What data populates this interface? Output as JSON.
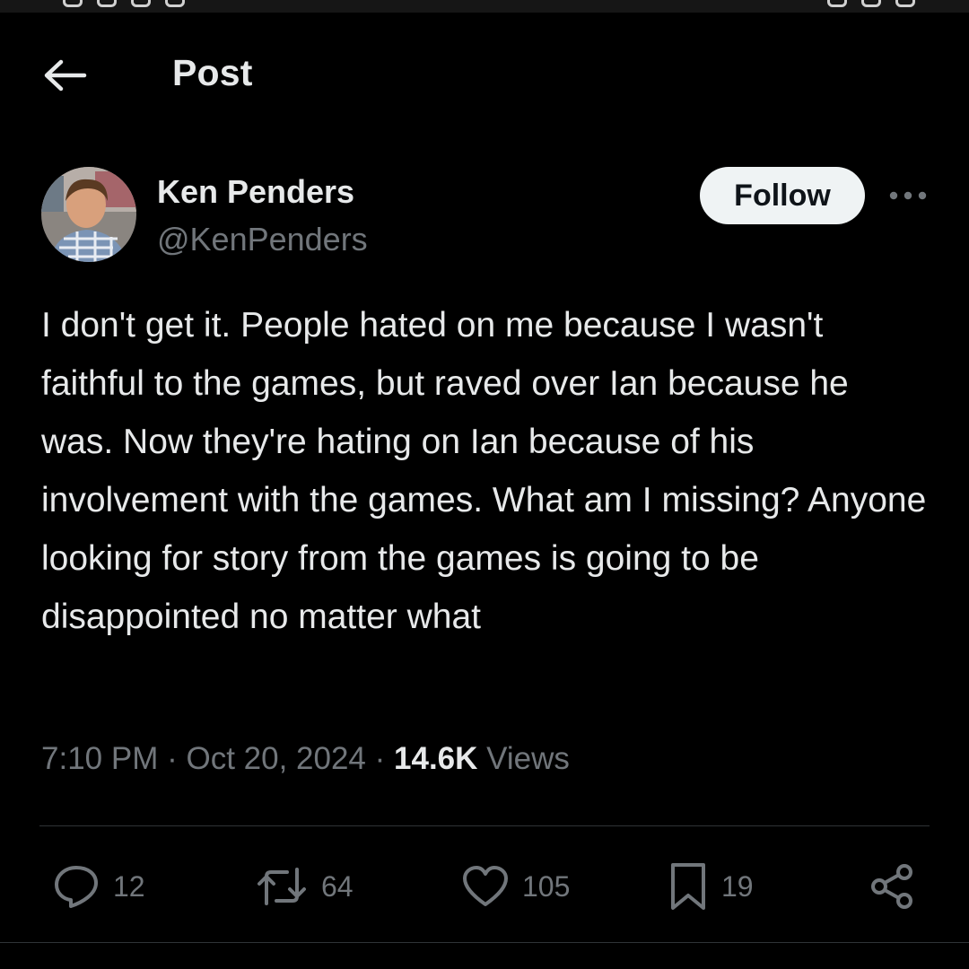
{
  "header": {
    "title": "Post",
    "back_icon": "arrow-left-icon"
  },
  "author": {
    "name": "Ken Penders",
    "handle": "@KenPenders",
    "follow_label": "Follow",
    "more_icon": "more-horizontal-icon"
  },
  "post": {
    "text": "I don't get it. People hated on me because I wasn't faithful to the games, but raved over Ian because he was. Now they're hating on Ian because of his involvement with the games. What am I missing? Anyone looking for story from the games is going to be disappointed no matter what",
    "time": "7:10 PM",
    "date": "Oct 20, 2024",
    "separator": "·",
    "views_count": "14.6K",
    "views_label": "Views"
  },
  "actions": {
    "replies": "12",
    "reposts": "64",
    "likes": "105",
    "bookmarks": "19"
  },
  "colors": {
    "background": "#000000",
    "text_primary": "#e7e9ea",
    "text_secondary": "#71767b",
    "divider": "#2f3336",
    "follow_bg": "#eff3f4"
  }
}
